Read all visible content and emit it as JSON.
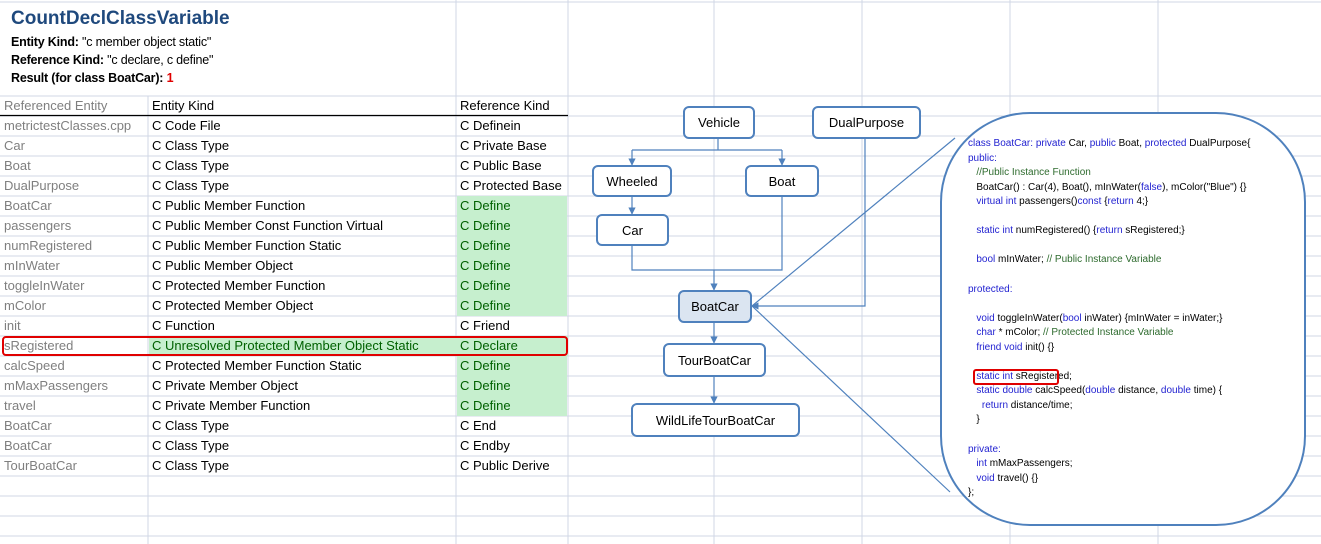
{
  "header": {
    "title": "CountDeclClassVariable",
    "entity_kind_label": "Entity Kind:",
    "entity_kind_value": "\"c member object static\"",
    "reference_kind_label": "Reference Kind:",
    "reference_kind_value": "\"c declare, c define\"",
    "result_label": "Result  (for class BoatCar):",
    "result_value": "1"
  },
  "table": {
    "columns": [
      "Referenced Entity",
      "Entity Kind",
      "Reference Kind"
    ],
    "rows": [
      {
        "entity": "metrictestClasses.cpp",
        "kind": "C Code File",
        "ref": "C Definein",
        "green": false
      },
      {
        "entity": "Car",
        "kind": "C Class Type",
        "ref": "C Private Base",
        "green": false
      },
      {
        "entity": "Boat",
        "kind": "C Class Type",
        "ref": "C Public Base",
        "green": false
      },
      {
        "entity": "DualPurpose",
        "kind": "C Class Type",
        "ref": "C Protected Base",
        "green": false
      },
      {
        "entity": "BoatCar",
        "kind": "C Public Member Function",
        "ref": "C Define",
        "green": true
      },
      {
        "entity": "passengers",
        "kind": "C Public Member Const Function Virtual",
        "ref": "C Define",
        "green": true
      },
      {
        "entity": "numRegistered",
        "kind": "C Public Member Function Static",
        "ref": "C Define",
        "green": true
      },
      {
        "entity": "mInWater",
        "kind": "C Public Member Object",
        "ref": "C Define",
        "green": true
      },
      {
        "entity": "toggleInWater",
        "kind": "C Protected Member Function",
        "ref": "C Define",
        "green": true
      },
      {
        "entity": "mColor",
        "kind": "C Protected Member Object",
        "ref": "C Define",
        "green": true
      },
      {
        "entity": "init",
        "kind": "C Function",
        "ref": "C Friend",
        "green": false
      },
      {
        "entity": "sRegistered",
        "kind": "C Unresolved Protected Member Object Static",
        "ref": "C Declare",
        "green": true,
        "highlight": true
      },
      {
        "entity": "calcSpeed",
        "kind": "C Protected Member Function Static",
        "ref": "C Define",
        "green": true
      },
      {
        "entity": "mMaxPassengers",
        "kind": "C Private Member Object",
        "ref": "C Define",
        "green": true
      },
      {
        "entity": "travel",
        "kind": "C Private Member Function",
        "ref": "C Define",
        "green": true
      },
      {
        "entity": "BoatCar",
        "kind": "C Class Type",
        "ref": "C End",
        "green": false
      },
      {
        "entity": "BoatCar",
        "kind": "C Class Type",
        "ref": "C Endby",
        "green": false
      },
      {
        "entity": "TourBoatCar",
        "kind": "C Class Type",
        "ref": "C Public Derive",
        "green": false
      }
    ]
  },
  "diagram": {
    "nodes": {
      "vehicle": "Vehicle",
      "dualpurpose": "DualPurpose",
      "wheeled": "Wheeled",
      "boat": "Boat",
      "car": "Car",
      "boatcar": "BoatCar",
      "tourboatcar": "TourBoatCar",
      "wildlife": "WildLifeTourBoatCar"
    }
  },
  "code": {
    "lines": [
      [
        [
          "class BoatCar: ",
          "kw"
        ],
        [
          "private ",
          "kw"
        ],
        [
          "Car, ",
          ""
        ],
        [
          "public ",
          "kw"
        ],
        [
          "Boat, ",
          ""
        ],
        [
          "protected ",
          "kw"
        ],
        [
          "DualPurpose{",
          ""
        ]
      ],
      [
        [
          "public:",
          "kw"
        ]
      ],
      [
        [
          "   //Public Instance Function",
          "cm"
        ]
      ],
      [
        [
          "   BoatCar() : Car(4), Boat(), mInWater(",
          ""
        ],
        [
          "false",
          "kw"
        ],
        [
          "), mColor(\"Blue\") {}",
          ""
        ]
      ],
      [
        [
          "   virtual int ",
          "kw"
        ],
        [
          "passengers()",
          ""
        ],
        [
          "const ",
          "kw"
        ],
        [
          "{",
          ""
        ],
        [
          "return ",
          "kw"
        ],
        [
          "4;}",
          ""
        ]
      ],
      [
        [
          " ",
          ""
        ]
      ],
      [
        [
          "   static int ",
          "kw"
        ],
        [
          "numRegistered() {",
          ""
        ],
        [
          "return ",
          "kw"
        ],
        [
          "sRegistered;}",
          ""
        ]
      ],
      [
        [
          " ",
          ""
        ]
      ],
      [
        [
          "   bool ",
          "kw"
        ],
        [
          "mInWater; ",
          ""
        ],
        [
          "// Public Instance Variable",
          "cm"
        ]
      ],
      [
        [
          " ",
          ""
        ]
      ],
      [
        [
          "protected:",
          "kw"
        ]
      ],
      [
        [
          " ",
          ""
        ]
      ],
      [
        [
          "   void ",
          "kw"
        ],
        [
          "toggleInWater(",
          ""
        ],
        [
          "bool ",
          "kw"
        ],
        [
          "inWater) {mInWater = inWater;}",
          ""
        ]
      ],
      [
        [
          "   char ",
          "kw"
        ],
        [
          "* mColor; ",
          ""
        ],
        [
          "// Protected Instance Variable",
          "cm"
        ]
      ],
      [
        [
          "   friend void ",
          "kw"
        ],
        [
          "init() {}",
          ""
        ]
      ],
      [
        [
          " ",
          ""
        ]
      ],
      [
        [
          "   static int ",
          "kw"
        ],
        [
          "sRegistered;",
          ""
        ]
      ],
      [
        [
          "   static double ",
          "kw"
        ],
        [
          "calcSpeed(",
          ""
        ],
        [
          "double ",
          "kw"
        ],
        [
          "distance, ",
          ""
        ],
        [
          "double ",
          "kw"
        ],
        [
          "time) {",
          ""
        ]
      ],
      [
        [
          "     return ",
          "kw"
        ],
        [
          "distance/time;",
          ""
        ]
      ],
      [
        [
          "   }",
          ""
        ]
      ],
      [
        [
          " ",
          ""
        ]
      ],
      [
        [
          "private:",
          "kw"
        ]
      ],
      [
        [
          "   int ",
          "kw"
        ],
        [
          "mMaxPassengers;",
          ""
        ]
      ],
      [
        [
          "   void ",
          "kw"
        ],
        [
          "travel() {}",
          ""
        ]
      ],
      [
        [
          "};",
          ""
        ]
      ]
    ]
  },
  "colors": {
    "title": "#1f497d",
    "result": "#e00000",
    "green_fill": "#c6efce",
    "green_text": "#006100",
    "node_border": "#4f81bd",
    "highlight_border": "#e00000"
  }
}
